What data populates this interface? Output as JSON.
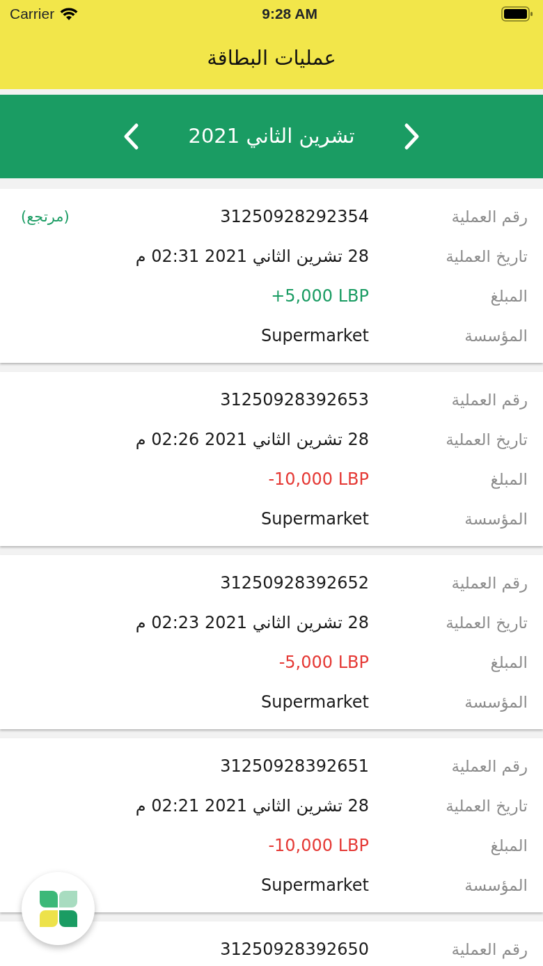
{
  "status_bar": {
    "carrier": "Carrier",
    "time": "9:28 AM"
  },
  "header": {
    "title": "عمليات البطاقة"
  },
  "month_bar": {
    "month": "تشرين الثاني 2021"
  },
  "transactions": [
    {
      "badge": "(مرتجع)",
      "rows": [
        {
          "label": "رقم العملية",
          "value": "31250928292354",
          "kind": "plain"
        },
        {
          "label": "تاريخ العملية",
          "value": "28 تشرين الثاني 2021 02:31 م",
          "kind": "plain"
        },
        {
          "label": "المبلغ",
          "value": "+5,000 LBP",
          "kind": "credit"
        },
        {
          "label": "المؤسسة",
          "value": "Supermarket",
          "kind": "plain"
        }
      ]
    },
    {
      "rows": [
        {
          "label": "رقم العملية",
          "value": "31250928392653",
          "kind": "plain"
        },
        {
          "label": "تاريخ العملية",
          "value": "28 تشرين الثاني 2021 02:26 م",
          "kind": "plain"
        },
        {
          "label": "المبلغ",
          "value": "-10,000 LBP",
          "kind": "debit"
        },
        {
          "label": "المؤسسة",
          "value": "Supermarket",
          "kind": "plain"
        }
      ]
    },
    {
      "rows": [
        {
          "label": "رقم العملية",
          "value": "31250928392652",
          "kind": "plain"
        },
        {
          "label": "تاريخ العملية",
          "value": "28 تشرين الثاني 2021 02:23 م",
          "kind": "plain"
        },
        {
          "label": "المبلغ",
          "value": "-5,000 LBP",
          "kind": "debit"
        },
        {
          "label": "المؤسسة",
          "value": "Supermarket",
          "kind": "plain"
        }
      ]
    },
    {
      "rows": [
        {
          "label": "رقم العملية",
          "value": "31250928392651",
          "kind": "plain"
        },
        {
          "label": "تاريخ العملية",
          "value": "28 تشرين الثاني 2021 02:21 م",
          "kind": "plain"
        },
        {
          "label": "المبلغ",
          "value": "-10,000 LBP",
          "kind": "debit"
        },
        {
          "label": "المؤسسة",
          "value": "Supermarket",
          "kind": "plain"
        }
      ]
    },
    {
      "rows": [
        {
          "label": "رقم العملية",
          "value": "31250928392650",
          "kind": "plain"
        }
      ]
    }
  ]
}
